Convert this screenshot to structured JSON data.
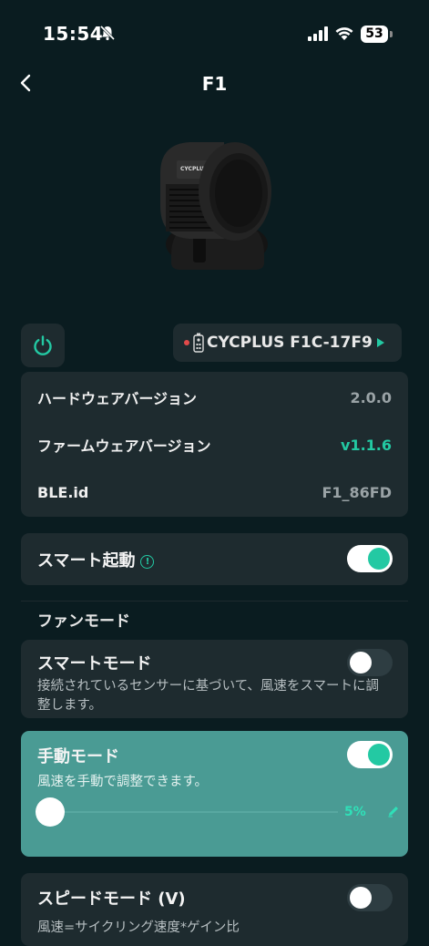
{
  "status_bar": {
    "time": "15:54",
    "battery": "53"
  },
  "nav": {
    "title": "F1"
  },
  "device": {
    "name": "CYCPLUS F1C-17F9",
    "brand_text": "CYCPLUS"
  },
  "info": {
    "rows": [
      {
        "label": "ハードウェアバージョン",
        "value": "2.0.0"
      },
      {
        "label": "ファームウェアバージョン",
        "value": "v1.1.6"
      },
      {
        "label": "BLE.id",
        "value": "F1_86FD"
      }
    ]
  },
  "smart_start": {
    "label": "スマート起動",
    "enabled": true
  },
  "fan_mode": {
    "section_title": "ファンモード",
    "modes": [
      {
        "title": "スマートモード",
        "description": "接続されているセンサーに基づいて、風速をスマートに調整します。",
        "enabled": false
      },
      {
        "title": "手動モード",
        "description": "風速を手動で調整できます。",
        "enabled": true,
        "speed_percent": "5%"
      },
      {
        "title": "スピードモード (V)",
        "description": "風速=サイクリング速度*ゲイン比",
        "enabled": false
      }
    ]
  },
  "colors": {
    "accent": "#23c9a3",
    "background": "#0a1c20",
    "card": "#1e2b2f",
    "active_card": "#4a9b94",
    "dot": "#e24a4a"
  }
}
